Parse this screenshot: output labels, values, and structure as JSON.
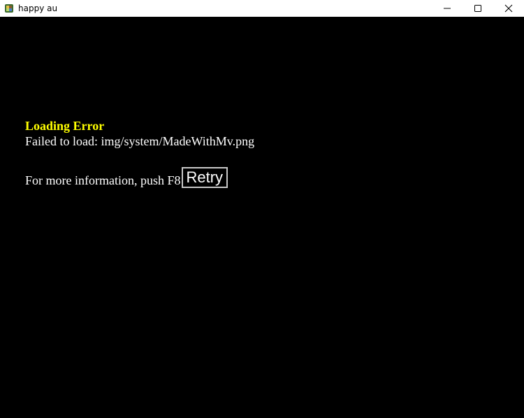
{
  "window": {
    "title": "happy au",
    "app_icon": "rpg-maker-app-icon",
    "controls": {
      "minimize": "minimize-icon",
      "maximize": "maximize-icon",
      "close": "close-icon"
    }
  },
  "error": {
    "title": "Loading Error",
    "message": "Failed to load: img/system/MadeWithMv.png",
    "info": "For more information, push F8",
    "retry_label": "Retry"
  },
  "colors": {
    "background": "#000000",
    "error_title": "#ffff00",
    "text": "#ffffff"
  }
}
